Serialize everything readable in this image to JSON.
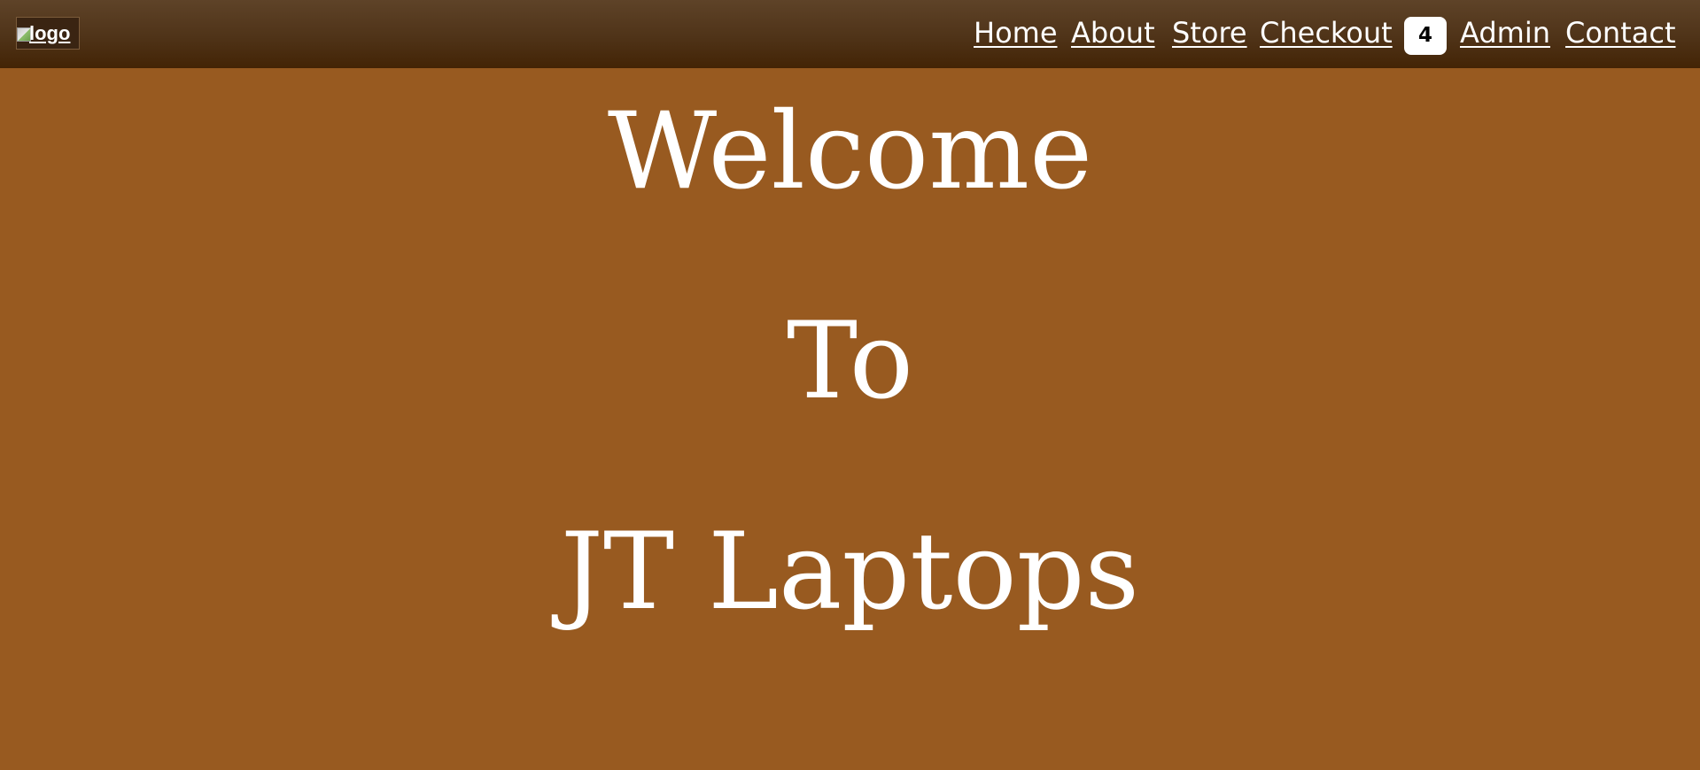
{
  "header": {
    "logo_alt": "logo",
    "nav": [
      {
        "label": "Home"
      },
      {
        "label": "About"
      },
      {
        "label": "Store"
      },
      {
        "label": "Checkout"
      },
      {
        "label": "Admin"
      },
      {
        "label": "Contact"
      }
    ],
    "cart_count": "4"
  },
  "hero": {
    "line1": "Welcome",
    "line2": "To",
    "line3": "JT Laptops"
  },
  "colors": {
    "page_background": "#985a20",
    "header_background": "#4f3318",
    "text": "#ffffff",
    "badge_background": "#ffffff"
  }
}
